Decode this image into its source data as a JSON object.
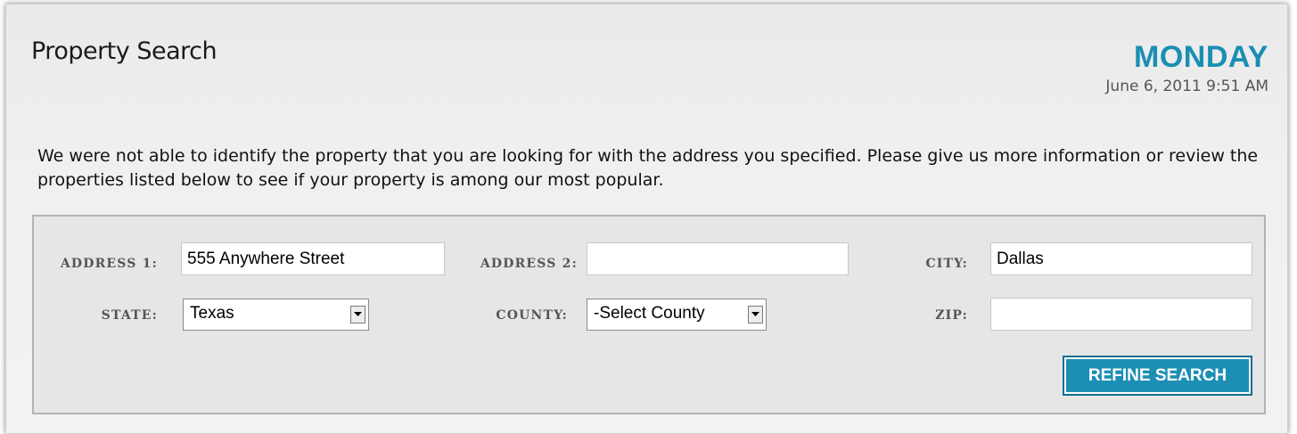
{
  "header": {
    "title": "Property Search",
    "day": "MONDAY",
    "datetime": "June 6, 2011 9:51 AM"
  },
  "message": "We were not able to identify the property that you are looking for with the address you specified. Please give us more information or review the properties listed below to see if your property is among our most popular.",
  "form": {
    "address1": {
      "label": "ADDRESS 1:",
      "value": "555 Anywhere Street"
    },
    "address2": {
      "label": "ADDRESS 2:",
      "value": ""
    },
    "city": {
      "label": "CITY:",
      "value": "Dallas"
    },
    "state": {
      "label": "STATE:",
      "selected": "Texas"
    },
    "county": {
      "label": "COUNTY:",
      "selected": "-Select County"
    },
    "zip": {
      "label": "ZIP:",
      "value": ""
    },
    "submit_label": "REFINE SEARCH"
  },
  "colors": {
    "accent": "#1a8fb3",
    "button": "#1d8fb5"
  },
  "icons": {
    "dropdown": "chevron-down-icon"
  }
}
